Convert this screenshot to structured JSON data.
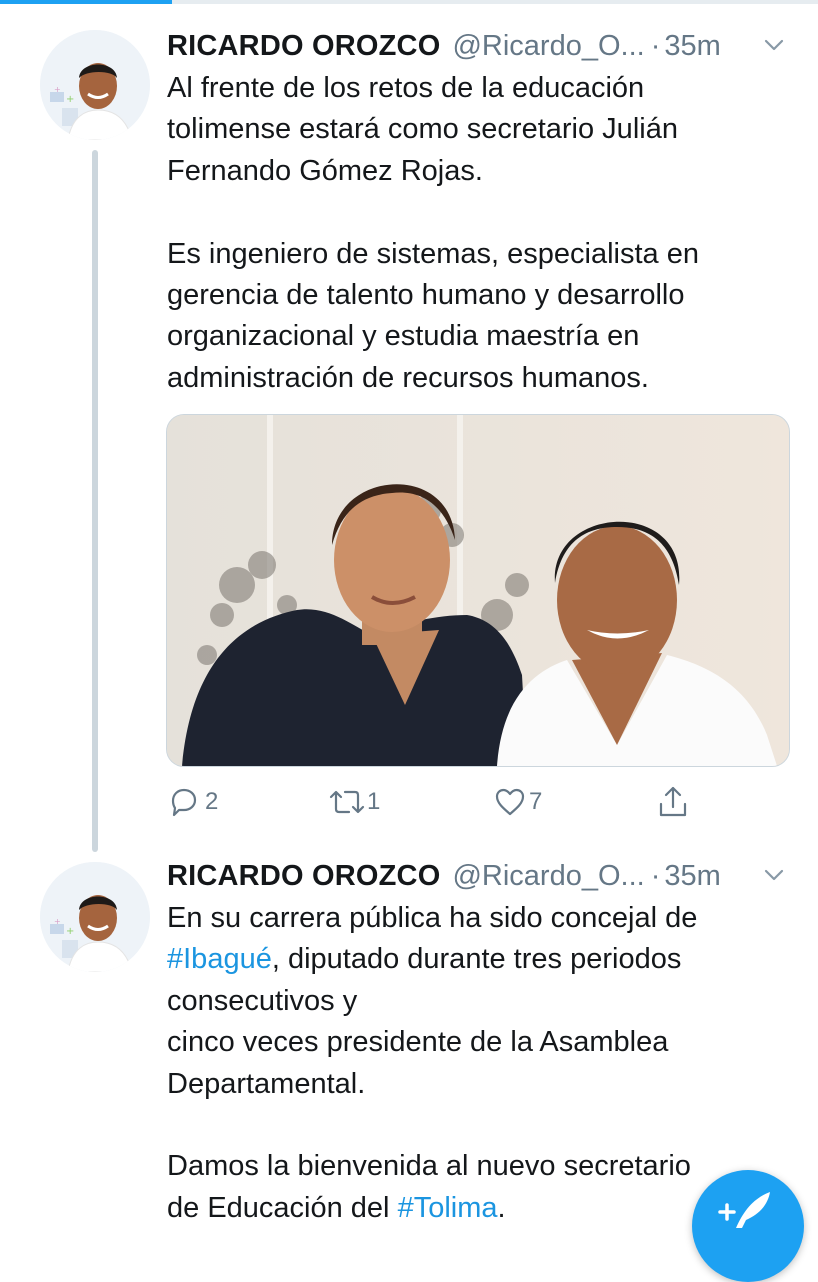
{
  "progress": {
    "fraction": 0.21
  },
  "tweets": [
    {
      "name": "RICARDO OROZCO",
      "handle": "@Ricardo_O...",
      "separator": "·",
      "time": "35m",
      "lines": [
        "Al frente de los retos de la educación",
        "tolimense estará como secretario Julián",
        "Fernando Gómez Rojas.",
        "Es ingeniero de sistemas, especialista en",
        "gerencia de talento humano y desarrollo",
        "organizacional y estudia maestría en",
        "administración de recursos humanos."
      ],
      "actions": {
        "reply_count": "2",
        "retweet_count": "1",
        "like_count": "7"
      }
    },
    {
      "name": "RICARDO OROZCO",
      "handle": "@Ricardo_O...",
      "separator": "·",
      "time": "35m",
      "line1": "En su carrera pública ha sido concejal de",
      "hashtag1": "#Ibagué",
      "line2_rest": ", diputado durante tres periodos",
      "line3": "consecutivos y",
      "line4": "cinco veces presidente de la Asamblea",
      "line5": "Departamental.",
      "line6": "Damos la bienvenida al nuevo secretario",
      "line7_start": "de Educación del ",
      "hashtag2": "#Tolima",
      "line7_end": "."
    }
  ],
  "icons": {
    "reply": "reply-icon",
    "retweet": "retweet-icon",
    "like": "heart-icon",
    "share": "share-icon",
    "caret": "chevron-down-icon",
    "compose": "compose-tweet-icon"
  },
  "colors": {
    "accent": "#1da1f2",
    "hashtag": "#1b95e0",
    "secondary_text": "#657786",
    "thread_line": "#ccd6dd"
  }
}
